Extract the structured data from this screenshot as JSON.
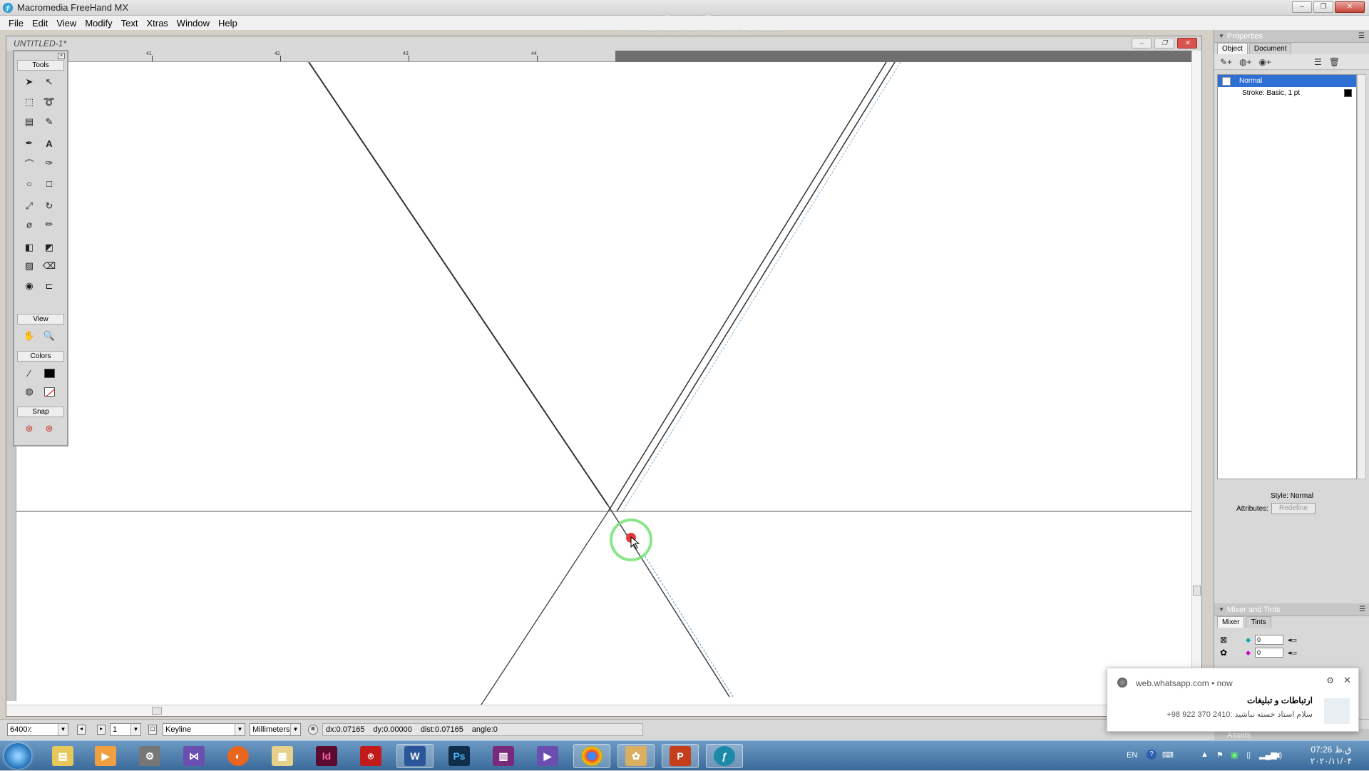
{
  "app": {
    "title": "Macromedia FreeHand MX"
  },
  "watermark": "www.zdsoft.com",
  "menu": [
    "File",
    "Edit",
    "View",
    "Modify",
    "Text",
    "Xtras",
    "Window",
    "Help"
  ],
  "document": {
    "title": "UNTITLED-1*"
  },
  "ruler": {
    "labels": [
      "41",
      "42",
      "43",
      "44"
    ]
  },
  "toolbox": {
    "sections": {
      "tools": "Tools",
      "view": "View",
      "colors": "Colors",
      "snap": "Snap"
    }
  },
  "status": {
    "zoom": "6400٪",
    "page": "1",
    "view_mode": "Keyline",
    "units": "Millimeters",
    "dx": "dx:0.07165",
    "dy": "dy:0.00000",
    "dist": "dist:0.07165",
    "angle": "angle:0"
  },
  "properties": {
    "title": "Properties",
    "tabs": [
      "Object",
      "Document"
    ],
    "item_normal": "Normal",
    "item_stroke": "Stroke: Basic, 1 pt",
    "style_label": "Style: Normal",
    "attributes_label": "Attributes:",
    "redefine": "Redefine"
  },
  "mixer": {
    "title": "Mixer and Tints",
    "tabs": [
      "Mixer",
      "Tints"
    ],
    "value1": "0",
    "value2": "0"
  },
  "assets": {
    "title": "Assets"
  },
  "notification": {
    "source": "web.whatsapp.com",
    "time": "now",
    "sender": "ارتباطات و تبلیغات",
    "message": "سلام استاد خسته نباشید :2410 370 922 98+"
  },
  "tray": {
    "lang": "EN",
    "time": "07:26 ق.ظ",
    "date": "۲۰۲۰/۱۱/۰۴"
  },
  "colors": {
    "accent": "#2e6fd4",
    "toast_ring": "#4cd964"
  }
}
